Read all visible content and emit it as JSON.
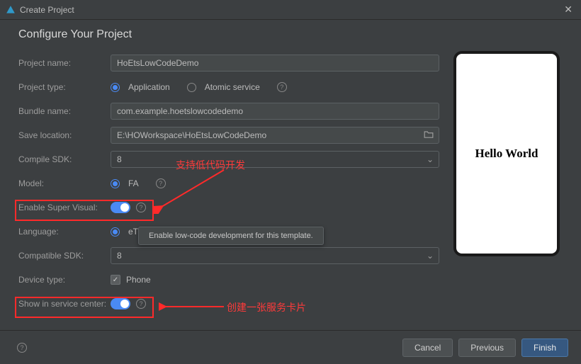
{
  "window": {
    "title": "Create Project"
  },
  "section_title": "Configure Your Project",
  "labels": {
    "project_name": "Project name:",
    "project_type": "Project type:",
    "bundle_name": "Bundle name:",
    "save_location": "Save location:",
    "compile_sdk": "Compile SDK:",
    "model": "Model:",
    "enable_super_visual": "Enable Super Visual:",
    "language": "Language:",
    "compatible_sdk": "Compatible SDK:",
    "device_type": "Device type:",
    "show_service_center": "Show in service center:"
  },
  "values": {
    "project_name": "HoEtsLowCodeDemo",
    "bundle_name": "com.example.hoetslowcodedemo",
    "save_location": "E:\\HOWorkspace\\HoEtsLowCodeDemo",
    "compile_sdk": "8",
    "compatible_sdk": "8"
  },
  "options": {
    "project_type_application": "Application",
    "project_type_atomic": "Atomic service",
    "model_fa": "FA",
    "language_ets": "eTS",
    "device_phone": "Phone"
  },
  "tooltip": "Enable low-code development for this template.",
  "annotations": {
    "low_code": "支持低代码开发",
    "service_card": "创建一张服务卡片"
  },
  "preview": {
    "text": "Hello World"
  },
  "buttons": {
    "cancel": "Cancel",
    "previous": "Previous",
    "finish": "Finish"
  }
}
